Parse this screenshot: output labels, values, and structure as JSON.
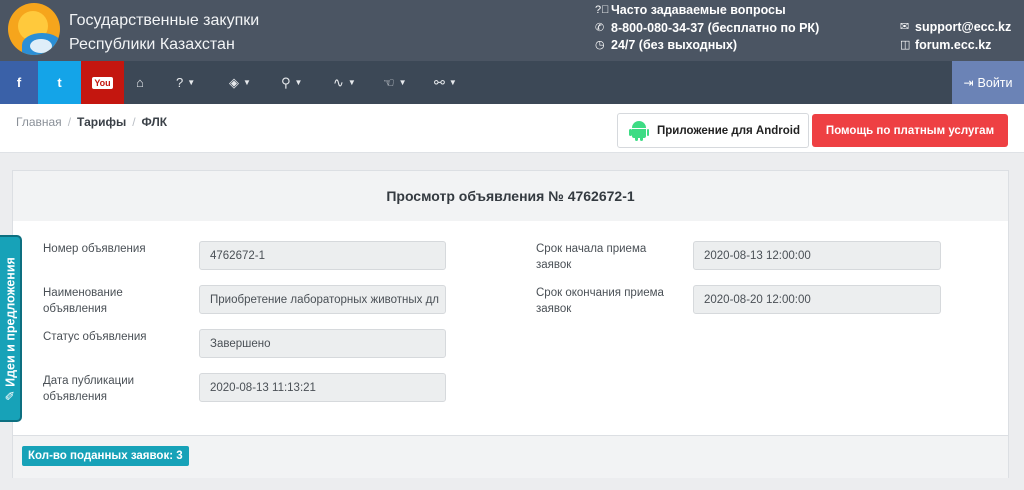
{
  "header": {
    "title_line1": "Государственные закупки",
    "title_line2": "Республики Казахстан",
    "faq_label": "Часто задаваемые вопросы",
    "phone": "8-800-080-34-37 (бесплатно по РК)",
    "hours": "24/7 (без выходных)",
    "email": "support@ecc.kz",
    "forum": "forum.ecc.kz"
  },
  "nav": {
    "facebook": "f",
    "twitter": "t",
    "youtube": "You",
    "login": "Войти",
    "items": [
      {
        "icon": "home-icon",
        "glyph": "⌂"
      },
      {
        "icon": "question-icon",
        "glyph": "?"
      },
      {
        "icon": "layers-icon",
        "glyph": "◈"
      },
      {
        "icon": "search-icon",
        "glyph": "⚲"
      },
      {
        "icon": "chart-icon",
        "glyph": "∿"
      },
      {
        "icon": "hand-icon",
        "glyph": "☜"
      },
      {
        "icon": "link-icon",
        "glyph": "⚯"
      }
    ]
  },
  "breadcrumb": [
    "Главная",
    "Тарифы",
    "ФЛК"
  ],
  "buttons": {
    "android": "Приложение для Android",
    "help": "Помощь по платным услугам"
  },
  "panel": {
    "title": "Просмотр объявления № 4762672-1",
    "fields_left": [
      {
        "label": "Номер объявления",
        "value": "4762672-1"
      },
      {
        "label": "Наименование объявления",
        "value": "Приобретение лабораторных животных дл"
      },
      {
        "label": "Статус объявления",
        "value": "Завершено"
      },
      {
        "label": "Дата публикации объявления",
        "value": "2020-08-13 11:13:21"
      }
    ],
    "fields_right": [
      {
        "label": "Срок начала приема заявок",
        "value": "2020-08-13 12:00:00"
      },
      {
        "label": "Срок окончания приема заявок",
        "value": "2020-08-20 12:00:00"
      }
    ],
    "applications_badge": "Кол-во поданных заявок: 3"
  },
  "side_tab": "Идеи и предложения",
  "colors": {
    "header_bg": "#4b5563",
    "nav_bg": "#3c4856",
    "facebook": "#3a61a8",
    "twitter": "#14a4e8",
    "youtube": "#c4160f",
    "login": "#6b83b6",
    "help_btn": "#ee4043",
    "badge": "#17a2b8"
  }
}
